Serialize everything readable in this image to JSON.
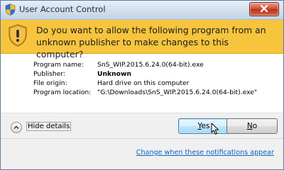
{
  "window": {
    "title": "User Account Control"
  },
  "banner": {
    "question": "Do you want to allow the following program from an unknown publisher to make changes to this computer?"
  },
  "details": [
    {
      "label": "Program name:",
      "value": "SnS_WIP.2015.6.24.0(64-bit).exe"
    },
    {
      "label": "Publisher:",
      "value": "Unknown"
    },
    {
      "label": "File origin:",
      "value": "Hard drive on this computer"
    },
    {
      "label": "Program location:",
      "value": "\"G:\\Downloads\\SnS_WIP.2015.6.24.0(64-bit).exe\""
    }
  ],
  "footer": {
    "hide_details_label": "Hide details",
    "yes_label_mnemonic": "Y",
    "yes_label_rest": "es",
    "no_label_mnemonic": "N",
    "no_label_rest": "o",
    "change_link": "Change when these notifications appear"
  },
  "icons": {
    "title": "uac-shield-icon",
    "banner": "warning-shield-icon",
    "close": "close-icon",
    "toggle": "chevron-up-icon",
    "cursor": "mouse-pointer-icon"
  },
  "colors": {
    "banner": "#f7c43e",
    "link": "#0b63c6",
    "close_button": "#cf4a31"
  }
}
